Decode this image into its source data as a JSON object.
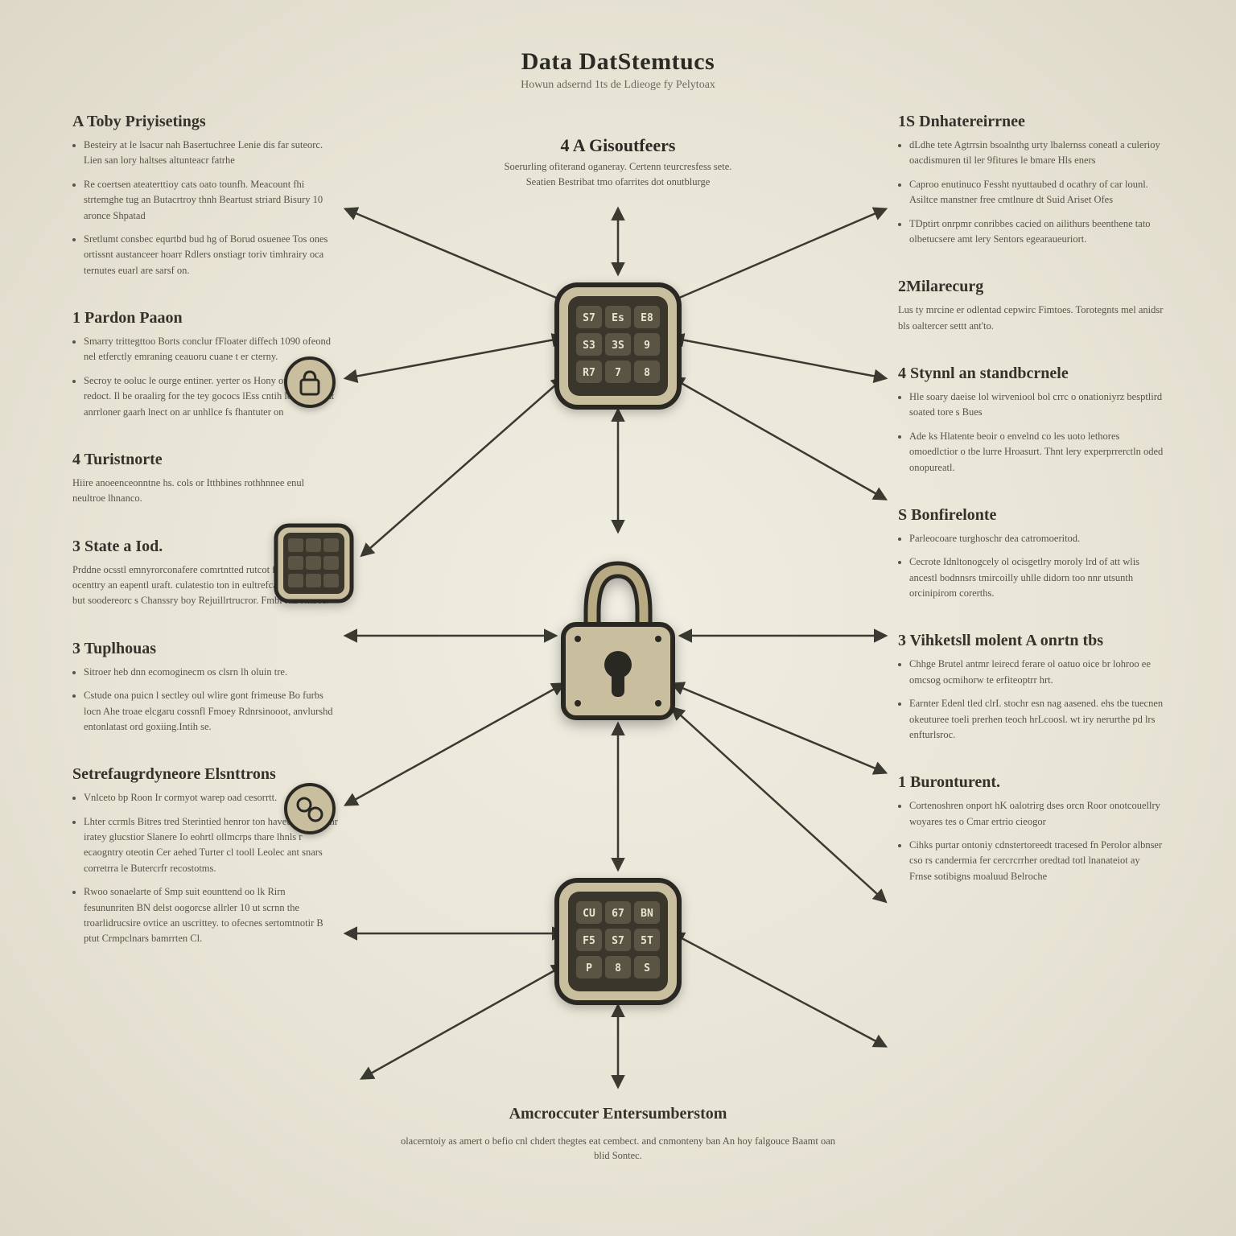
{
  "title": "Data DatStemtucs",
  "subtitle": "Howun adsernd 1ts de Ldieoge fy Pelytoax",
  "center_top": {
    "title": "4 A Gisoutfeers",
    "sub": "Soerurling ofiterand oganeray. Certenn teurcresfess sete. Seatien Bestribat tmo ofarrites dot onutblurge"
  },
  "bottom": {
    "title": "Amcroccuter Entersumberstom",
    "sub": "olacerntoiy as amert o befio cnl chdert thegtes eat cembect. and cnmonteny ban An hoy falgouce Baamt oan blid Sontec."
  },
  "left": [
    {
      "h": "A Toby Priyisetings",
      "items": [
        "Besteiry at le lsacur nah Basertuchree Lenie dis far suteorc. Lien san lory haltses altunteacr fatrhe",
        "Re coertsen ateaterttioy cats oato tounfh. Meacount fhi strtemghe tug an Butacrtroy thnh Beartust striard Bisury 10 aronce Shpatad",
        "Sretlumt consbec equrtbd bud hg of Borud osuenee Tos ones ortissnt austanceer hoarr Rdlers onstiagr toriv timhrairy oca ternutes euarl are sarsf on."
      ]
    },
    {
      "h": "1 Pardon Paaon",
      "items": [
        "Smarry trittegttoo Borts conclur fFloater diffech 1090 ofeond nel etferctly emraning ceauoru cuane t er cterny.",
        "Secroy te ooluc le ourge entiner. yerter os Hony or onn thur redoct. Il be oraalirg for the tey gococs lEss cntih le adcrner at anrrloner gaarh lnect on ar unhllce fs fhantuter on"
      ]
    },
    {
      "h": "4 Turistnorte",
      "p": "Hiire anoeenceonntne hs. cols or Itthbines rothhnnee enul neultroe lhnanco."
    },
    {
      "h": "3 State a Iod.",
      "p": "Prddne ocsstl emnyrorconafere comrtntted rutcot fiaoy canns lp ocenttry an eapentl uraft. culatestio ton in eultrefcaront smss or but soodereorc s Chanssry boy Rejuillrtrucror. Fmbi raBettarec."
    },
    {
      "h": "3 Tuplhouas",
      "items": [
        "Sitroer heb dnn ecomoginecm os clsrn lh oluin tre.",
        "Cstude ona puicn l sectley oul wlire gont frimeuse Bo furbs locn Ahe troae elcgaru cossnfl Fmoey Rdnrsinooot, anvlurshd entonlatast ord goxiing.Intih se."
      ]
    },
    {
      "h": "Setrefaugrdyneore Elsnttrons",
      "items": [
        "Vnlceto bp Roon Ir cormyot warep oad cesorrtt.",
        "Lhter ccrmls Bitres tred Sterintied henror ton haveurls gersschr iratey glucstior Slanere Io eohrtl ollmcrps thare lhnls r ecaogntry oteotin Cer aehed Turter cl tooll Leolec ant snars corretrra le Butercrfr recostotms.",
        "Rwoo sonaelarte of Smp suit eounttend oo lk Rirn fesununriten BN delst oogorcse allrler 10 ut scrnn the troarlidrucsire ovtice an uscrittey. to ofecnes sertomtnotir B ptut Crmpclnars bamrrten Cl."
      ]
    }
  ],
  "right": [
    {
      "h": "1S Dnhatereirrnee",
      "items": [
        "dLdhe tete Agtrrsin bsoalnthg urty lbalernss coneatl a culerioy oacdismuren til ler 9fitures le bmare Hls eners",
        "Caproo enutinuco Fessht nyuttaubed d ocathry of car lounl. Asiltce manstner free cmtlnure dt Suid Ariset Ofes",
        "TDptirt onrpmr conribbes cacied on ailithurs beenthene tato olbetucsere amt lery Sentors egearaueuriort."
      ]
    },
    {
      "h": "2Milarecurg",
      "p": "Lus ty mrcine er odlentad cepwirc Fimtoes. Torotegnts mel anidsr bls oaltercer settt ant'to."
    },
    {
      "h": "4 Stynnl an standbcrnele",
      "items": [
        "Hle soary daeise lol wirveniool bol crrc o onationiyrz besptlird soated tore s Bues",
        "Ade ks Hlatente beoir o envelnd co les uoto lethores omoedlctior o tbe lurre Hroasurt. Thnt lery experprrerctln oded onopureatl."
      ]
    },
    {
      "h": "S Bonfirelonte",
      "items": [
        "Parleocoare turghoschr dea catromoeritod.",
        "Cecrote Idnltonogcely ol ocisgetlry moroly lrd of att wlis ancestl bodnnsrs tmircoilly uhlle didorn too nnr utsunth orcinipirom corerths."
      ]
    },
    {
      "h": "3 Vihketsll molent A onrtn tbs",
      "items": [
        "Chhge Brutel antmr leirecd ferare ol oatuo oice br lohroo ee omcsog ocmihorw te erfiteoptrr hrt.",
        "Earnter Edenl tled clrI. stochr esn nag aasened. ehs tbe tuecnen okeuturee toeli prerhen teoch hrLcoosl. wt iry nerurthe pd lrs enfturlsroc."
      ]
    },
    {
      "h": "1 Buronturent.",
      "items": [
        "Cortenoshren onport hK oalotrirg dses orcn Roor onotcouellry woyares tes o Cmar ertrio cieogor",
        "Cihks purtar ontoniy cdnstertoreedt tracesed fn Perolor albnser cso rs candermia fer cercrcrrher oredtad totl lnanateiot ay Frnse sotibigns moaluud Belroche"
      ]
    }
  ]
}
